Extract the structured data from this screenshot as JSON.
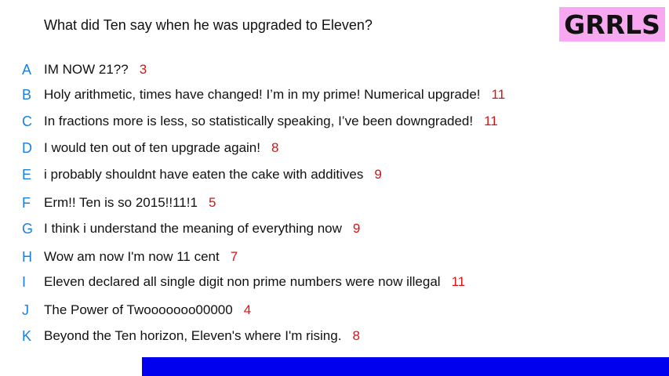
{
  "question": "What did Ten say when he was upgraded to Eleven?",
  "badge": "GRRLS",
  "colors": {
    "letter": "#1a7fe0",
    "score": "#dd1111",
    "badge_bg": "#f7a8f0",
    "bottom_bar": "#0000ee"
  },
  "answers": [
    {
      "letter": "A",
      "text": "IM NOW 21??",
      "score": "3"
    },
    {
      "letter": "B",
      "text": "Holy arithmetic, times have changed! I’m in my prime! Numerical upgrade!",
      "score": "11"
    },
    {
      "letter": "C",
      "text": "In fractions more is less, so statistically speaking, I’ve been downgraded!",
      "score": "11"
    },
    {
      "letter": "D",
      "text": "I would ten out of ten upgrade again!",
      "score": "8"
    },
    {
      "letter": "E",
      "text": "i probably shouldnt have eaten the cake with additives",
      "score": "9"
    },
    {
      "letter": "F",
      "text": "Erm!! Ten is so 2015!!11!1",
      "score": "5"
    },
    {
      "letter": "G",
      "text": "I think i understand the meaning of everything now",
      "score": "9"
    },
    {
      "letter": "H",
      "text": "Wow am now I'm now 11 cent",
      "score": "7"
    },
    {
      "letter": "I",
      "text": "Eleven declared all single digit non prime numbers were now illegal",
      "score": "11"
    },
    {
      "letter": "J",
      "text": "The Power of Twooooooo00000",
      "score": "4"
    },
    {
      "letter": "K",
      "text": "Beyond the Ten horizon, Eleven's where I'm rising.",
      "score": "8"
    }
  ]
}
